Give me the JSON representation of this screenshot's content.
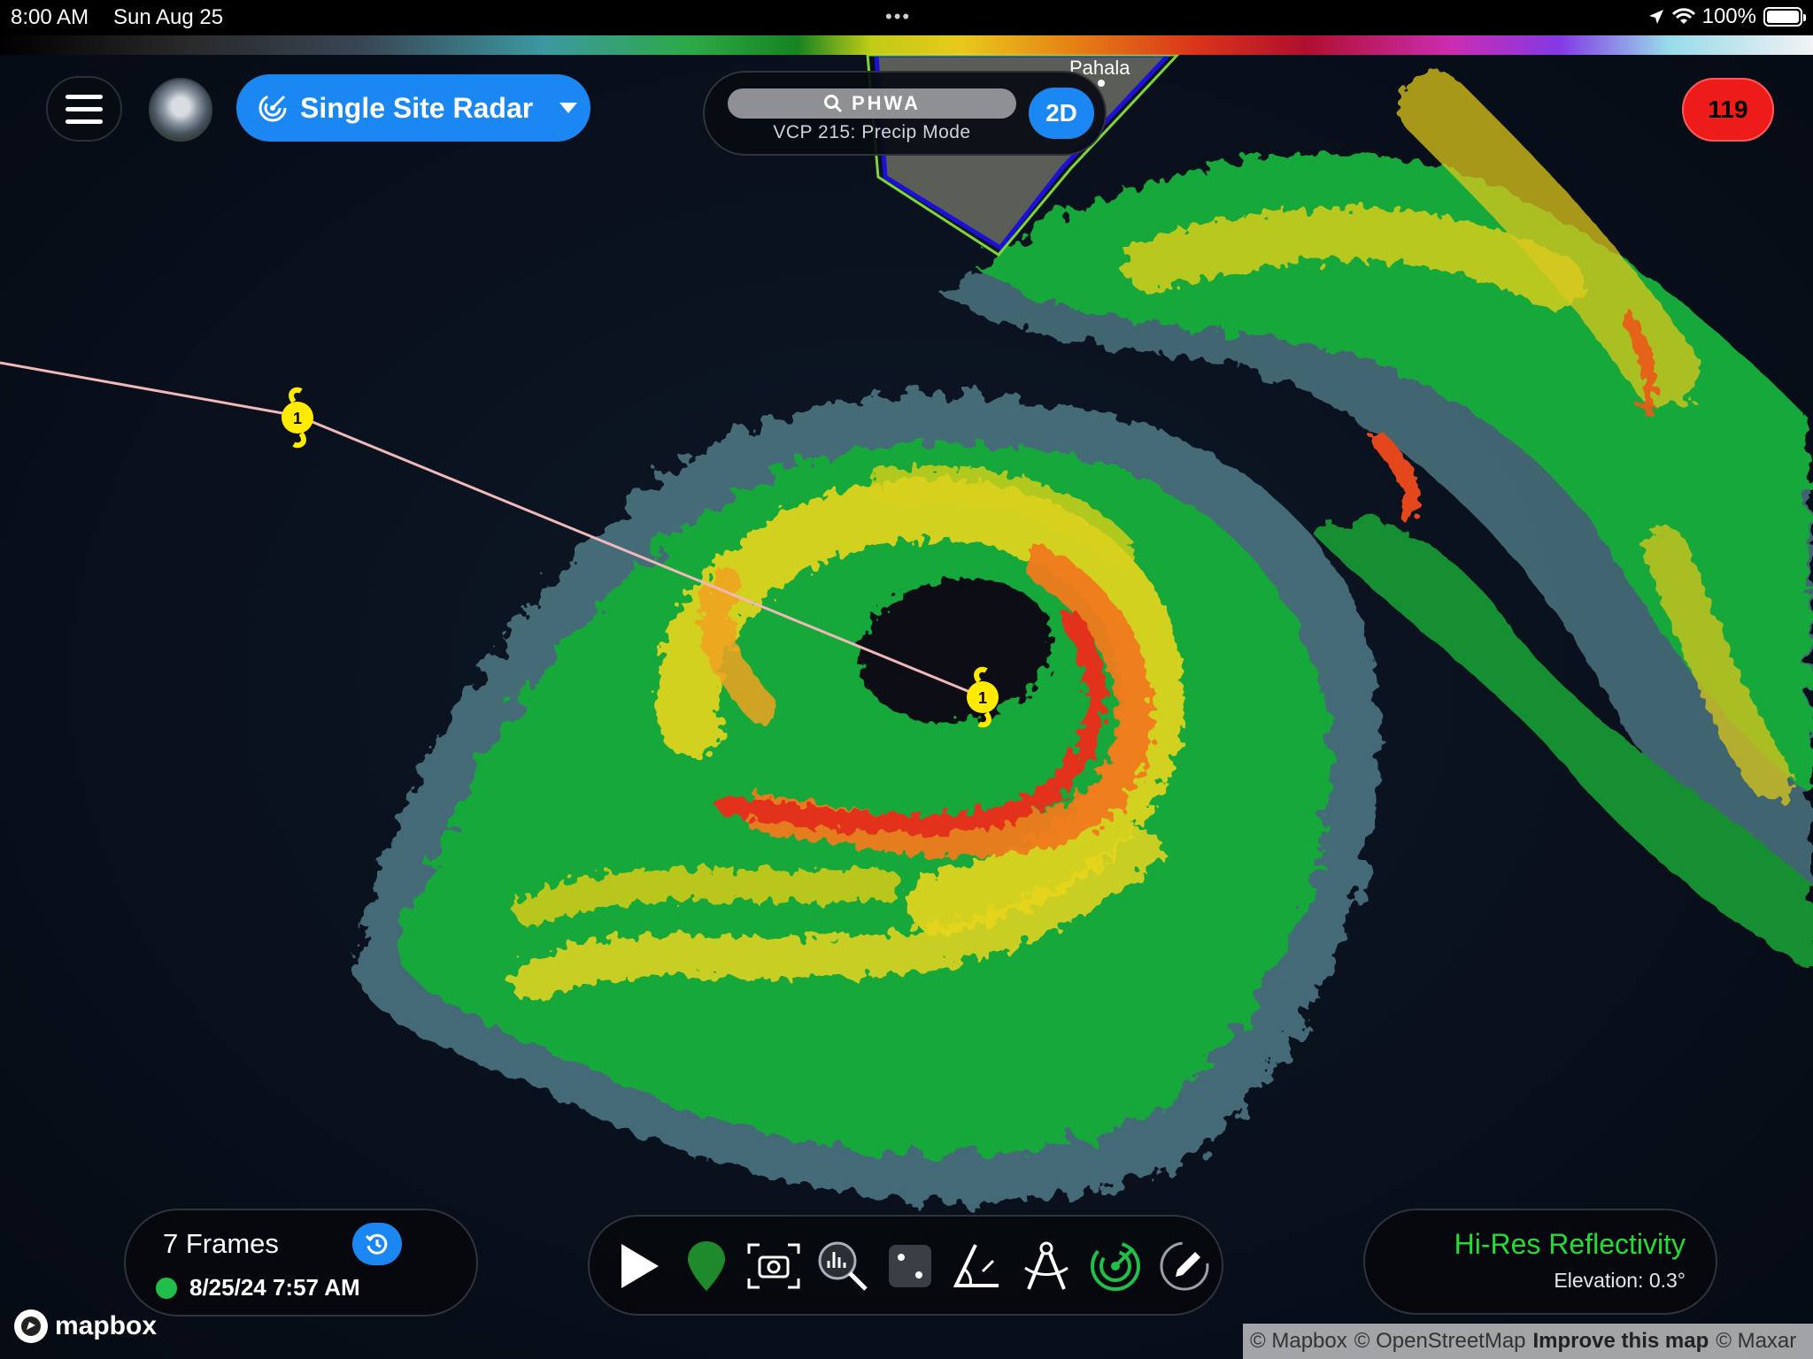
{
  "status_bar": {
    "time": "8:00 AM",
    "date": "Sun Aug 25",
    "dots": "•••",
    "battery": "100%",
    "icons": [
      "location-arrow-icon",
      "wifi-icon",
      "battery-icon"
    ]
  },
  "top_bar": {
    "menu_icon": "hamburger-menu-icon",
    "mode_label": "Single Site Radar",
    "mode_icon": "radar-icon",
    "accent_color": "#1b87f3"
  },
  "radar_site": {
    "search_text": "PHWA",
    "vcp_text": "VCP 215: Precip Mode",
    "view_toggle": "2D"
  },
  "alert_badge": {
    "count": "119",
    "color": "#ee1b1b"
  },
  "map": {
    "place_label": "Pahala",
    "storm_marker_label": "1",
    "track_color": "#f0b8b8"
  },
  "frames": {
    "label": "7 Frames",
    "timestamp": "8/25/24 7:57 AM",
    "live_color": "#1fbf4a"
  },
  "toolbar": {
    "tools": [
      "play-icon",
      "location-pin-icon",
      "camera-icon",
      "inspect-icon",
      "dice-icon",
      "measure-angle-icon",
      "compass-icon",
      "radar-sweep-icon",
      "pencil-icon"
    ]
  },
  "product": {
    "name": "Hi-Res Reflectivity",
    "elevation": "Elevation: 0.3°",
    "name_color": "#22dd33"
  },
  "attribution": {
    "logo_text": "mapbox",
    "mapbox": "© Mapbox",
    "osm": "© OpenStreetMap",
    "improve": "Improve this map",
    "maxar": "© Maxar"
  }
}
